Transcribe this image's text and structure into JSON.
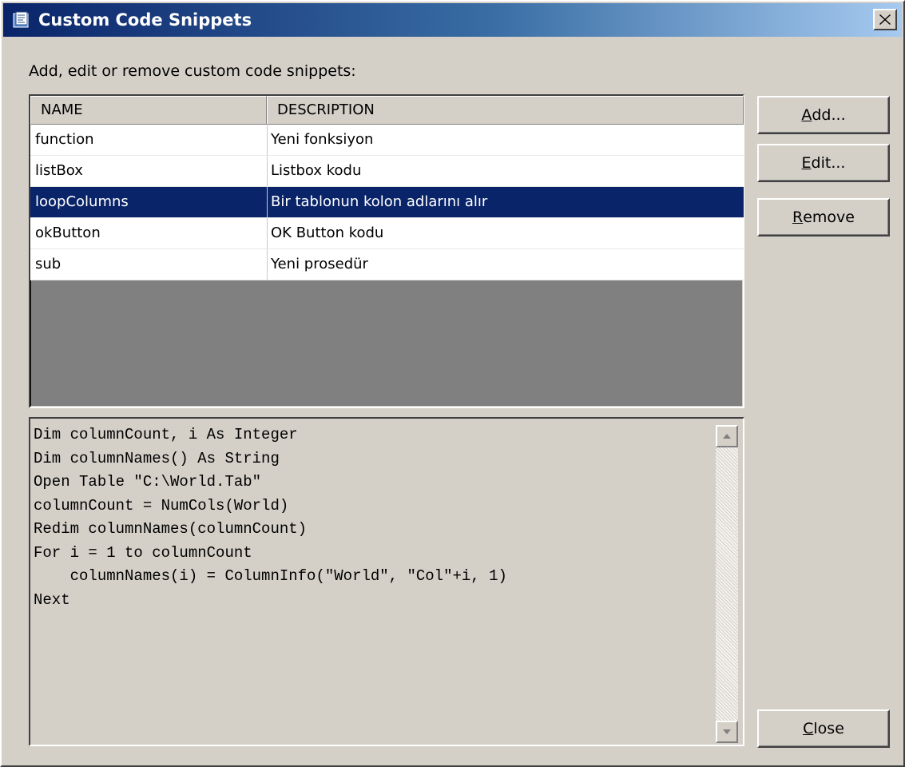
{
  "window": {
    "title": "Custom Code Snippets"
  },
  "instruction": "Add, edit or remove custom code snippets:",
  "list": {
    "columns": [
      "NAME",
      "DESCRIPTION"
    ],
    "rows": [
      {
        "name": "function",
        "description": "Yeni fonksiyon"
      },
      {
        "name": "listBox",
        "description": "Listbox kodu"
      },
      {
        "name": "loopColumns",
        "description": "Bir tablonun kolon adlarını alır"
      },
      {
        "name": "okButton",
        "description": "OK Button kodu"
      },
      {
        "name": "sub",
        "description": "Yeni prosedür"
      }
    ],
    "selected_index": 2
  },
  "code": {
    "lines": [
      "Dim columnCount, i As Integer",
      "Dim columnNames() As String",
      "Open Table \"C:\\World.Tab\"",
      "columnCount = NumCols(World)",
      "Redim columnNames(columnCount)",
      "For i = 1 to columnCount",
      "    columnNames(i) = ColumnInfo(\"World\", \"Col\"+i, 1)",
      "Next"
    ]
  },
  "buttons": {
    "add": {
      "mnemonic": "A",
      "rest": "dd..."
    },
    "edit": {
      "mnemonic": "E",
      "rest": "dit..."
    },
    "remove": {
      "mnemonic": "R",
      "rest": "emove"
    },
    "close": {
      "mnemonic": "C",
      "rest": "lose"
    }
  },
  "colors": {
    "face": "#d4d0c8",
    "selection": "#0a246a",
    "title_gradient_start": "#0a246a",
    "title_gradient_end": "#a6caf0"
  },
  "icons": {
    "app": "code-snippet-icon",
    "close": "close-icon",
    "scroll_up": "scroll-up-arrow-icon",
    "scroll_down": "scroll-down-arrow-icon"
  }
}
